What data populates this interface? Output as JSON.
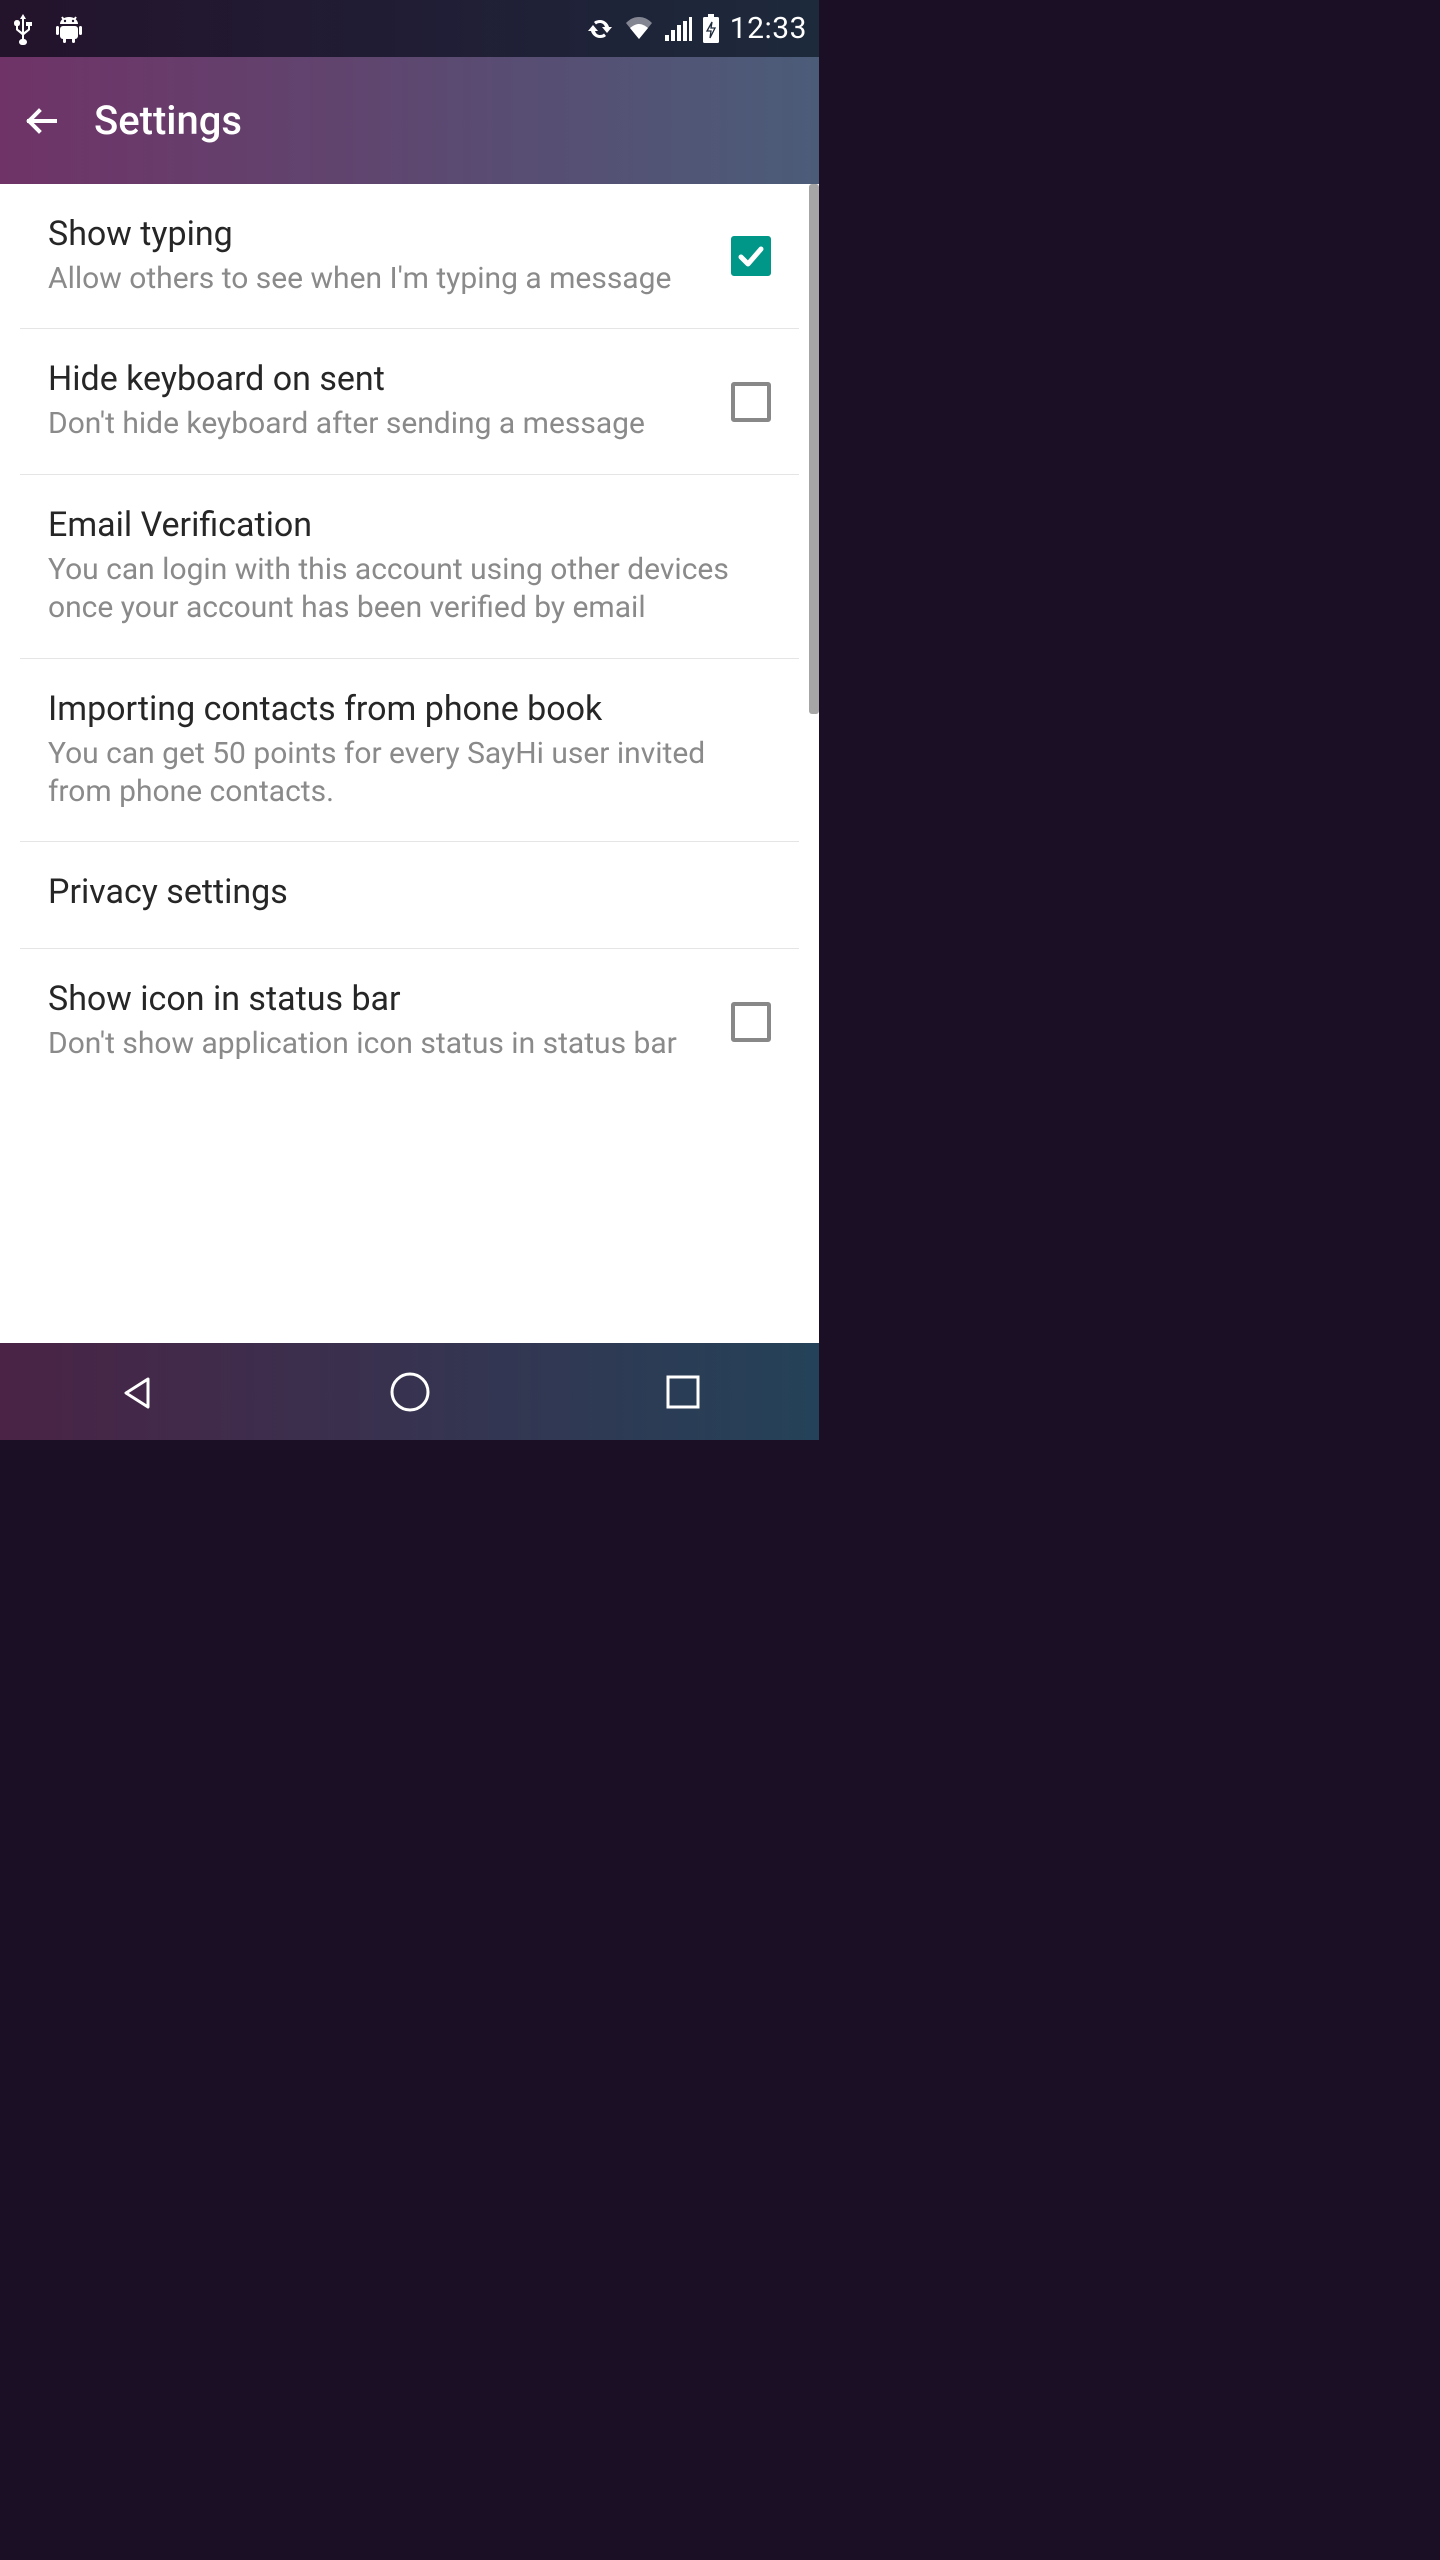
{
  "status": {
    "time": "12:33"
  },
  "header": {
    "title": "Settings"
  },
  "rows": [
    {
      "title": "Show typing",
      "sub": "Allow others to see when I'm typing a message",
      "checked": true,
      "hasCheckbox": true
    },
    {
      "title": "Hide keyboard on sent",
      "sub": "Don't hide keyboard after sending a message",
      "checked": false,
      "hasCheckbox": true
    },
    {
      "title": "Email Verification",
      "sub": "You can login with this account using other devices once your account has been verified by email",
      "hasCheckbox": false
    },
    {
      "title": "Importing contacts from phone book",
      "sub": "You can get 50 points for every SayHi user invited from phone contacts.",
      "hasCheckbox": false
    },
    {
      "title": "Privacy settings",
      "sub": "",
      "hasCheckbox": false
    },
    {
      "title": "Show icon in status bar",
      "sub": "Don't show application icon status in status bar",
      "checked": false,
      "hasCheckbox": true
    }
  ]
}
